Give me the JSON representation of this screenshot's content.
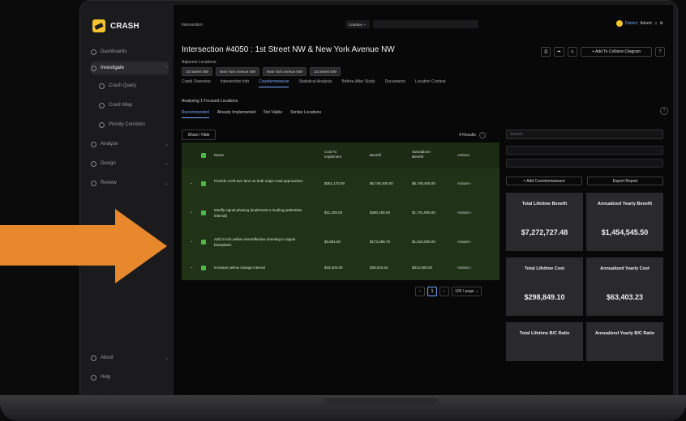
{
  "app": {
    "name": "CRASH"
  },
  "sidebar": {
    "items": [
      {
        "label": "Dashboards"
      },
      {
        "label": "Investigate"
      },
      {
        "label": "Crash Query"
      },
      {
        "label": "Crash Map"
      },
      {
        "label": "Priority Corridors"
      },
      {
        "label": "Analyze"
      },
      {
        "label": "Design"
      },
      {
        "label": "Review"
      },
      {
        "label": "About"
      },
      {
        "label": "Help"
      }
    ]
  },
  "topbar": {
    "breadcrumb": "Intersection",
    "select": "Crashes",
    "org": "District",
    "user": "Advert"
  },
  "header": {
    "title": "Intersection #4050 : 1st Street NW & New York Avenue NW",
    "adjacent_label": "Adjacent Locations:",
    "chips": [
      "1st Street NW",
      "New York Avenue NW",
      "New York Avenue NW",
      "1st Street NW"
    ],
    "add_button": "+ Add To Collision Diagram"
  },
  "tabs": [
    {
      "label": "Crash Overview"
    },
    {
      "label": "Intersection Info"
    },
    {
      "label": "Countermeasure"
    },
    {
      "label": "Statistical Analysis"
    },
    {
      "label": "Before-After Study"
    },
    {
      "label": "Documents"
    },
    {
      "label": "Location Context"
    }
  ],
  "analyzing": "Analyzing 1 Focused Locations",
  "subtabs": [
    {
      "label": "Recommended"
    },
    {
      "label": "Already Implemented"
    },
    {
      "label": "Not Viable"
    },
    {
      "label": "Similar Locations"
    }
  ],
  "table": {
    "show_hide": "Show / Hide",
    "results": "4 Results",
    "columns": [
      "Name",
      "Cost To Implement",
      "Benefit",
      "Standalone Benefit",
      "Actions"
    ],
    "rows": [
      {
        "name": "Provide a left-turn lane on both major-road approaches",
        "cost": "$351,172.50",
        "benefit": "$5,748,400.00",
        "standalone": "$5,748,400.00",
        "action": "Actions"
      },
      {
        "name": "Modify signal phasing (implement a leading pedestrian interval)",
        "cost": "$11,325.00",
        "benefit": "$380,185.00",
        "standalone": "$1,741,000.00",
        "action": "Actions"
      },
      {
        "name": "Add 3-inch yellow retroreflective sheeting to signal backplates",
        "cost": "$3,851.50",
        "benefit": "$173,286.70",
        "standalone": "$1,814,000.00",
        "action": "Actions"
      },
      {
        "name": "Increase yellow change interval",
        "cost": "$18,300.00",
        "benefit": "$30,043.54",
        "standalone": "$312,600.00",
        "action": "Actions"
      }
    ]
  },
  "pager": {
    "current": "1",
    "page_size": "100 / page"
  },
  "right_panel": {
    "search_placeholder": "Search",
    "add_button": "+ Add Countermeasure",
    "export_button": "Export Report",
    "metrics": [
      {
        "label": "Total Lifetime Benefit",
        "value": ""
      },
      {
        "label": "Annualized Yearly Benefit",
        "value": ""
      },
      {
        "label": "",
        "value": "$7,272,727.48"
      },
      {
        "label": "",
        "value": "$1,454,545.50"
      },
      {
        "label": "Total Lifetime Cost",
        "value": "$298,849.10"
      },
      {
        "label": "Annualized Yearly Cost",
        "value": "$63,403.23"
      },
      {
        "label": "Total Lifetime B/C Ratio",
        "value": ""
      },
      {
        "label": "Annualized Yearly B/C Ratio",
        "value": ""
      }
    ]
  }
}
